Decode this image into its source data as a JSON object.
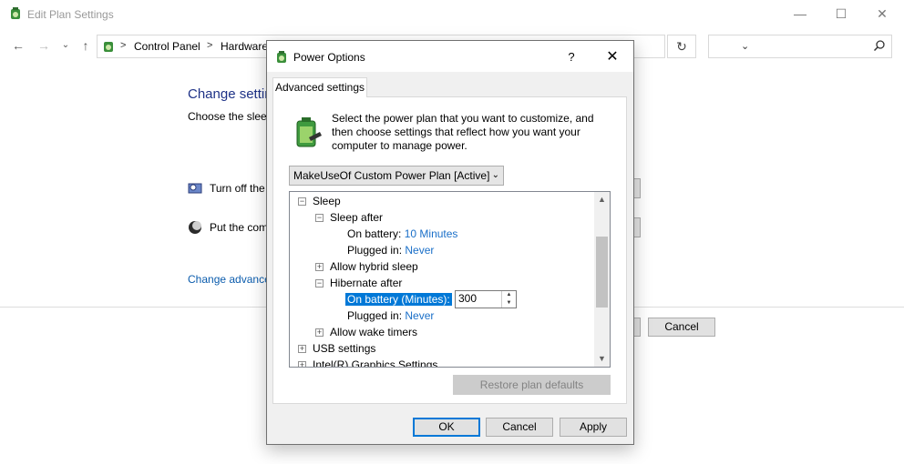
{
  "window": {
    "title": "Edit Plan Settings",
    "controls": {
      "minimize": "—",
      "maximize": "☐",
      "close": "✕"
    }
  },
  "address_bar": {
    "crumbs": [
      "Control Panel",
      "Hardware"
    ],
    "separator": ">",
    "refresh": "↻"
  },
  "main": {
    "heading": "Change settings for the plan",
    "subtitle": "Choose the sleep and display settings",
    "row_display": "Turn off the display:",
    "row_sleep": "Put the computer to sleep:",
    "advanced_link": "Change advanced power settings",
    "cancel_label": "Cancel"
  },
  "dialog": {
    "title": "Power Options",
    "help": "?",
    "close": "✕",
    "tab": "Advanced settings",
    "intro": "Select the power plan that you want to customize, and then choose settings that reflect how you want your computer to manage power.",
    "plan_selected": "MakeUseOf Custom Power Plan [Active]",
    "tree": {
      "sleep": "Sleep",
      "sleep_after": "Sleep after",
      "on_battery_label": "On battery:",
      "on_battery_value": "10 Minutes",
      "plugged_in_label": "Plugged in:",
      "plugged_in_value": "Never",
      "hybrid_sleep": "Allow hybrid sleep",
      "hibernate_after": "Hibernate after",
      "hib_battery_label": "On battery (Minutes):",
      "hib_battery_value": "300",
      "hib_plugged_label": "Plugged in:",
      "hib_plugged_value": "Never",
      "wake_timers": "Allow wake timers",
      "usb": "USB settings",
      "intel_graphics": "Intel(R) Graphics Settings"
    },
    "restore_label": "Restore plan defaults",
    "ok_label": "OK",
    "cancel_label": "Cancel",
    "apply_label": "Apply"
  },
  "icons": [
    "power-plan-icon",
    "back-arrow-icon",
    "forward-arrow-icon",
    "recent-dropdown-icon",
    "up-arrow-icon",
    "refresh-icon",
    "search-icon",
    "monitor-clock-icon",
    "moon-icon",
    "battery-plug-icon",
    "expand-icon",
    "collapse-icon"
  ],
  "colors": {
    "heading": "#1e3287",
    "link": "#0b5cad",
    "value": "#1a6fc8",
    "selection": "#0078d7"
  }
}
